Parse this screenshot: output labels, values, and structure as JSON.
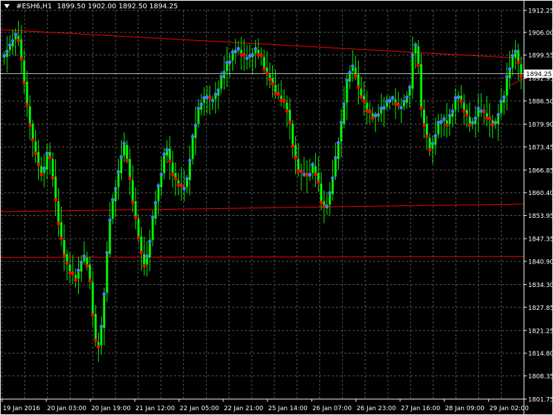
{
  "header": {
    "symbol": "#ESH6,H1",
    "ohlc": "1899.50 1902.00 1892.50 1894.25"
  },
  "colors": {
    "background": "#000000",
    "grid": "#5a5a5a",
    "axis": "#ffffff",
    "candle": "#00ff00",
    "trendline": "#ff0000",
    "bid_line": "#c0c0c0",
    "dot_red": "#ff0000",
    "dot_blue": "#4a7cff"
  },
  "chart_data": {
    "type": "line",
    "y_axis": {
      "min": 1801.75,
      "max": 1912.25,
      "ticks": [
        "1912.25",
        "1906.00",
        "1899.55",
        "1892.95",
        "1886.50",
        "1879.90",
        "1873.45",
        "1866.85",
        "1860.40",
        "1853.95",
        "1847.35",
        "1840.90",
        "1834.30",
        "1827.85",
        "1821.25",
        "1814.80",
        "1808.35",
        "1801.75"
      ]
    },
    "x_axis": {
      "ticks": [
        "19 Jan 2016",
        "20 Jan 03:00",
        "20 Jan 19:00",
        "21 Jan 12:00",
        "22 Jan 05:00",
        "22 Jan 21:00",
        "25 Jan 14:00",
        "26 Jan 07:00",
        "26 Jan 23:00",
        "27 Jan 16:00",
        "28 Jan 09:00",
        "29 Jan 02:00"
      ]
    },
    "current_price": "1894.25",
    "grid": true,
    "closes": [
      1899,
      1901,
      1902,
      1904,
      1905,
      1904,
      1898,
      1892,
      1885,
      1880,
      1875,
      1872,
      1868,
      1866,
      1867,
      1872,
      1870,
      1865,
      1858,
      1852,
      1847,
      1843,
      1840,
      1838,
      1837,
      1836,
      1838,
      1841,
      1842,
      1840,
      1835,
      1826,
      1818,
      1817,
      1822,
      1832,
      1843,
      1853,
      1858,
      1862,
      1866,
      1871,
      1874,
      1870,
      1864,
      1858,
      1853,
      1848,
      1843,
      1840,
      1842,
      1847,
      1853,
      1858,
      1862,
      1866,
      1871,
      1873,
      1869,
      1866,
      1864,
      1863,
      1862,
      1862,
      1864,
      1870,
      1876,
      1880,
      1884,
      1886,
      1887,
      1888,
      1887,
      1887,
      1888,
      1890,
      1893,
      1895,
      1897,
      1898,
      1900,
      1901,
      1901,
      1900,
      1899,
      1899,
      1899,
      1900,
      1901,
      1900,
      1899,
      1896,
      1894,
      1893,
      1891,
      1889,
      1888,
      1887,
      1886,
      1884,
      1880,
      1874,
      1870,
      1867,
      1866,
      1866,
      1865,
      1866,
      1868,
      1866,
      1863,
      1858,
      1856,
      1857,
      1860,
      1865,
      1870,
      1875,
      1880,
      1886,
      1892,
      1895,
      1896,
      1894,
      1890,
      1888,
      1886,
      1884,
      1883,
      1882,
      1882,
      1883,
      1884,
      1885,
      1886,
      1887,
      1887,
      1886,
      1885,
      1885,
      1886,
      1888,
      1890,
      1900,
      1902,
      1897,
      1884,
      1880,
      1876,
      1873,
      1874,
      1877,
      1880,
      1881,
      1881,
      1880,
      1882,
      1884,
      1887,
      1888,
      1886,
      1884,
      1882,
      1880,
      1880,
      1882,
      1884,
      1884,
      1883,
      1882,
      1881,
      1880,
      1880,
      1883,
      1886,
      1888,
      1893,
      1896,
      1899,
      1901,
      1897,
      1894
    ],
    "trendlines": [
      {
        "x1": 0,
        "y1": 1906.8,
        "x2": 1,
        "y2": 1898.6
      },
      {
        "x1": 0,
        "y1": 1855.0,
        "x2": 1,
        "y2": 1857.2
      },
      {
        "x1": 0,
        "y1": 1842.0,
        "x2": 1,
        "y2": 1842.3
      },
      {
        "x1": 0.975,
        "y1": 1891.0,
        "x2": 1,
        "y2": 1892.9
      }
    ]
  }
}
